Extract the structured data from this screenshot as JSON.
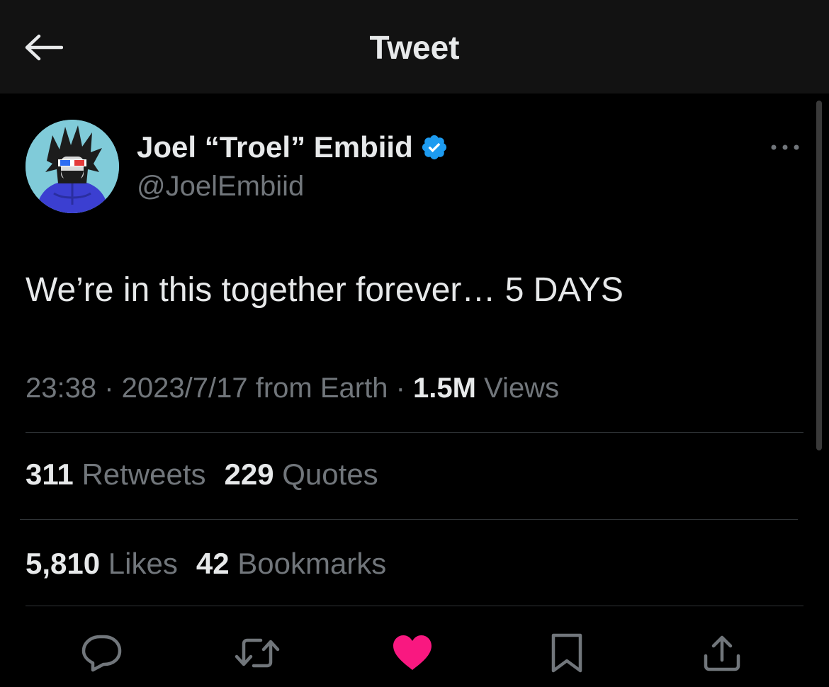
{
  "header": {
    "title": "Tweet",
    "back_icon": "arrow-left-icon"
  },
  "author": {
    "display_name": "Joel “Troel” Embiid",
    "handle": "@JoelEmbiid",
    "verified": true,
    "verified_color": "#1d9bf0"
  },
  "tweet": {
    "text": "We’re in this together forever… 5 DAYS",
    "time": "23:38",
    "date": "2023/7/17",
    "source": "from Earth",
    "views_count": "1.5M",
    "views_label": "Views"
  },
  "stats": {
    "retweets_count": "311",
    "retweets_label": "Retweets",
    "quotes_count": "229",
    "quotes_label": "Quotes",
    "likes_count": "5,810",
    "likes_label": "Likes",
    "bookmarks_count": "42",
    "bookmarks_label": "Bookmarks"
  },
  "actions": [
    {
      "icon": "reply-icon"
    },
    {
      "icon": "retweet-icon"
    },
    {
      "icon": "heart-icon",
      "active": true,
      "color": "#f91880"
    },
    {
      "icon": "bookmark-icon"
    },
    {
      "icon": "share-icon"
    }
  ],
  "colors": {
    "background": "#000000",
    "header_bg": "#121212",
    "text_primary": "#e7e9ea",
    "text_secondary": "#71767b",
    "divider": "#2f3336",
    "like_active": "#f91880"
  }
}
